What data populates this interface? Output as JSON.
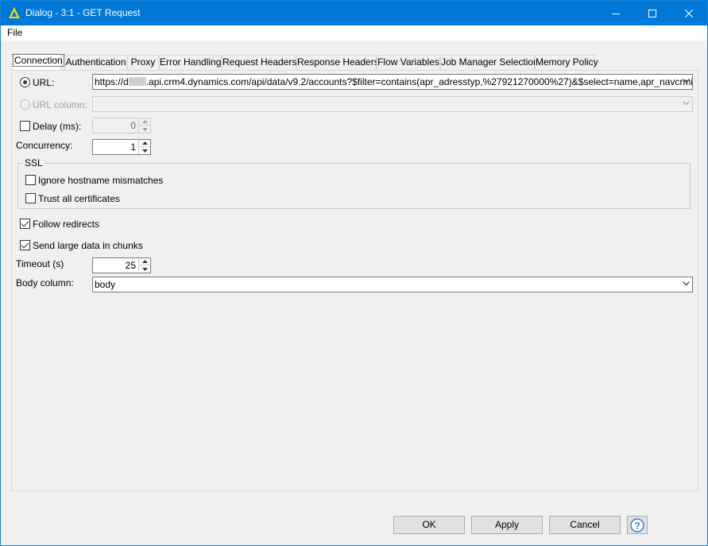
{
  "window": {
    "title": "Dialog - 3:1 - GET Request",
    "accent": "#0078d7"
  },
  "menu": {
    "file": "File"
  },
  "tabs": [
    {
      "label": "Connection",
      "active": true
    },
    {
      "label": "Authentication"
    },
    {
      "label": "Proxy"
    },
    {
      "label": "Error Handling"
    },
    {
      "label": "Request Headers"
    },
    {
      "label": "Response Headers"
    },
    {
      "label": "Flow Variables"
    },
    {
      "label": "Job Manager Selection"
    },
    {
      "label": "Memory Policy"
    }
  ],
  "connection": {
    "url_label": "URL:",
    "url_value_prefix": "https://d",
    "url_value_suffix": ".api.crm4.dynamics.com/api/data/v9.2/accounts?$filter=contains(apr_adresstyp,%27921270000%27)&$select=name,apr_navcrmid",
    "url_column_label": "URL column:",
    "delay_label": "Delay (ms):",
    "delay_value": "0",
    "concurrency_label": "Concurrency:",
    "concurrency_value": "1",
    "ssl_title": "SSL",
    "ignore_hostname_label": "Ignore hostname mismatches",
    "trust_all_label": "Trust all certificates",
    "follow_redirects_label": "Follow redirects",
    "send_chunks_label": "Send large data in chunks",
    "timeout_label": "Timeout (s)",
    "timeout_value": "25",
    "body_column_label": "Body column:",
    "body_column_value": "body"
  },
  "buttons": {
    "ok": "OK",
    "apply": "Apply",
    "cancel": "Cancel",
    "help": "?"
  }
}
